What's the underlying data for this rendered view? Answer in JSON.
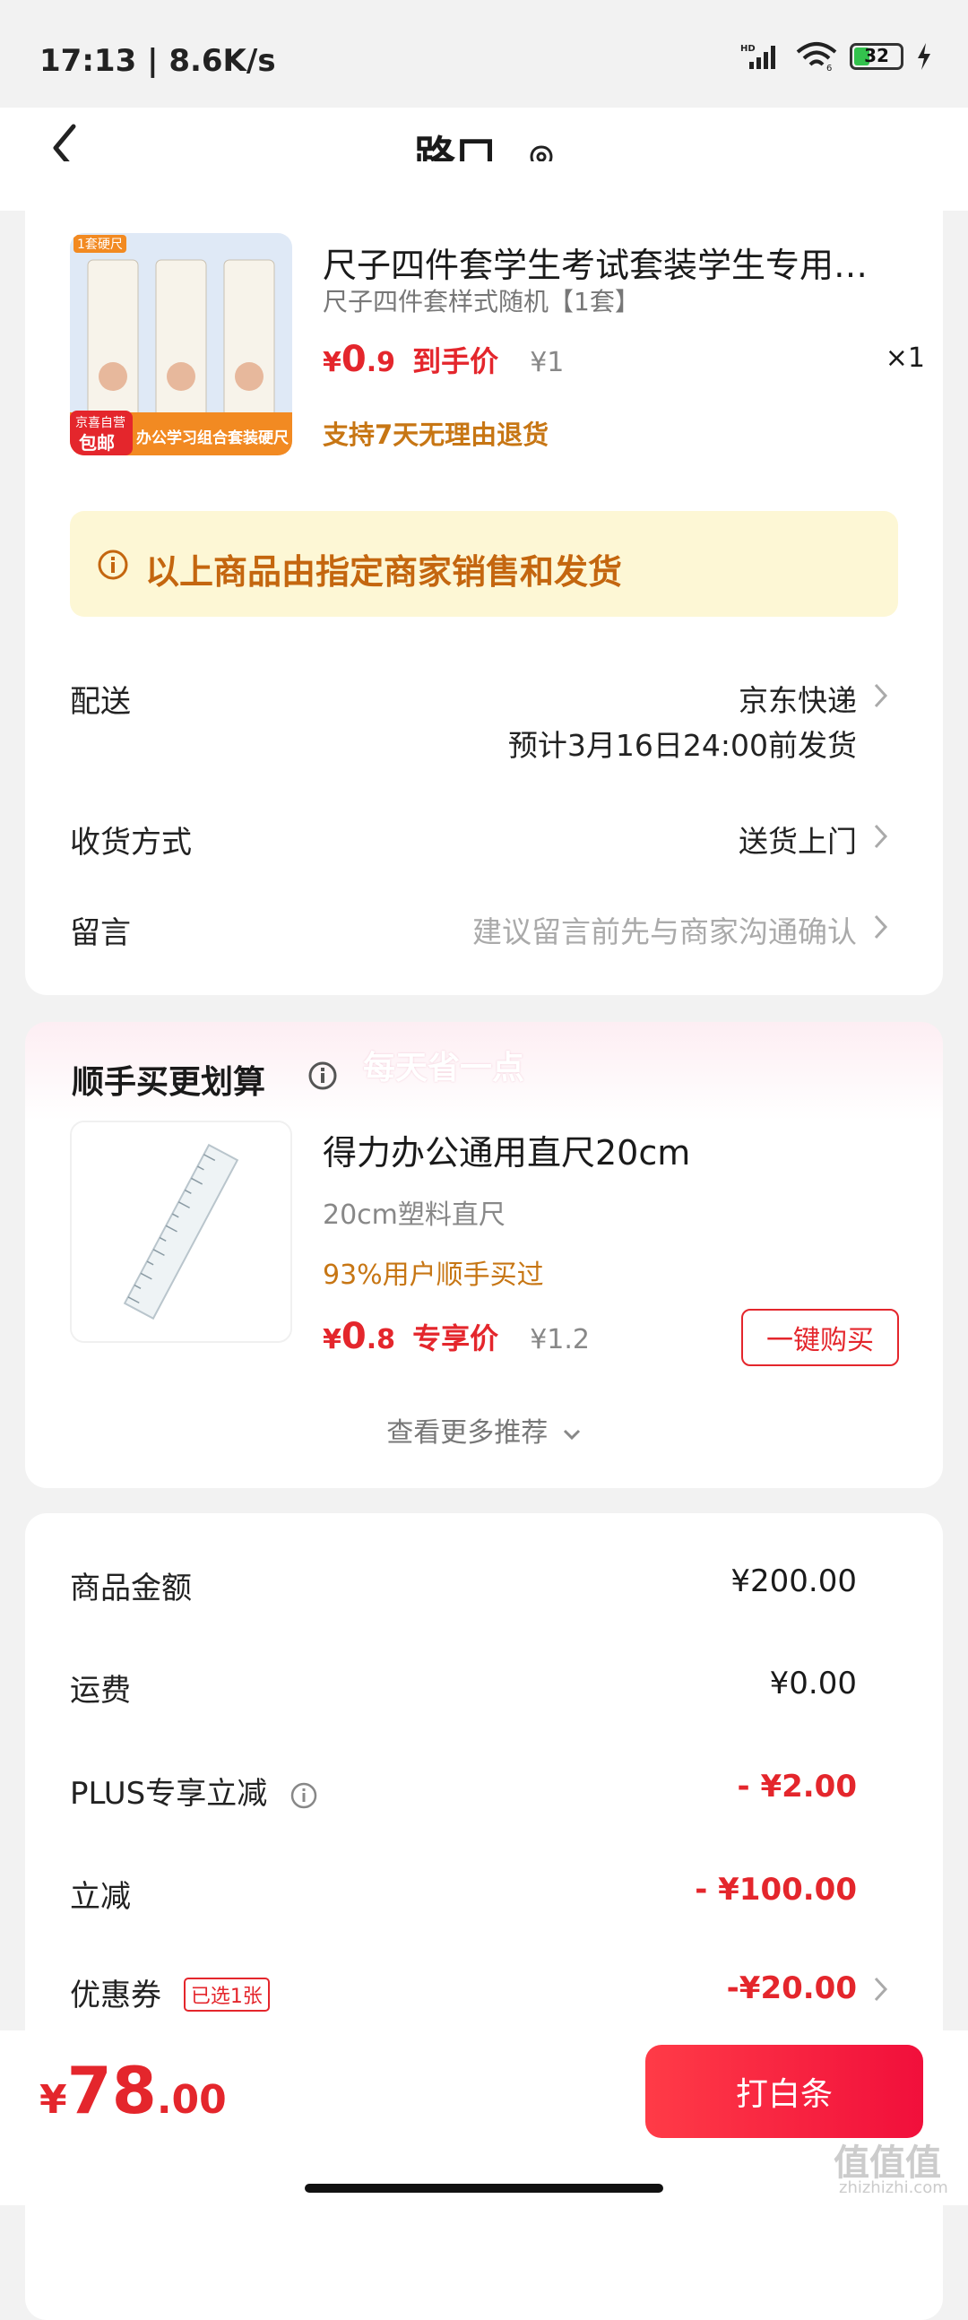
{
  "status_bar": {
    "time": "17:13 | 8.6K/s",
    "battery": "32",
    "battery_level": 0.32
  },
  "header": {
    "title": "路口"
  },
  "product": {
    "name": "尺子四件套学生考试套装学生专用套...",
    "spec": "尺子四件套样式随机【1套】",
    "price_symbol": "¥",
    "price_int": "0",
    "price_dec": ".9",
    "price_tag": "到手价",
    "original_price": "¥1",
    "qty": "×1",
    "return_policy": "支持7天无理由退货",
    "thumb_badge_top": "1套硬尺",
    "thumb_badge_self": "京喜自营",
    "thumb_badge_ship": "包邮",
    "thumb_banner": "办公学习组合套装硬尺"
  },
  "notice": "以上商品由指定商家销售和发货",
  "delivery": {
    "label": "配送",
    "value": "京东快递",
    "eta": "预计3月16日24:00前发货",
    "method_label": "收货方式",
    "method_value": "送货上门",
    "message_label": "留言",
    "message_placeholder": "建议留言前先与商家沟通确认"
  },
  "recommend": {
    "title": "顺手买更划算",
    "slogan": "每天省一点",
    "name": "得力办公通用直尺20cm",
    "spec": "20cm塑料直尺",
    "bought": "93%用户顺手买过",
    "price_symbol": "¥",
    "price_int": "0",
    "price_dec": ".8",
    "price_tag": "专享价",
    "original_price": "¥1.2",
    "buy_button": "一键购买",
    "more": "查看更多推荐"
  },
  "summary": {
    "goods_label": "商品金额",
    "goods_value": "¥200.00",
    "freight_label": "运费",
    "freight_value": "¥0.00",
    "plus_label": "PLUS专享立减",
    "plus_value": "- ¥2.00",
    "discount_label": "立减",
    "discount_value": "- ¥100.00",
    "coupon_label": "优惠券",
    "coupon_badge": "已选1张",
    "coupon_value": "-¥20.00"
  },
  "bottom": {
    "total_symbol": "¥",
    "total_int": "78",
    "total_dec": ".00",
    "pay_button": "打白条"
  },
  "watermark": {
    "logo": "值值值",
    "domain": "zhizhizhi.com"
  },
  "colors": {
    "accent": "#e4262c",
    "notice_bg": "#fdf7d5",
    "notice_text": "#c4660f",
    "highlight": "#c77614"
  }
}
